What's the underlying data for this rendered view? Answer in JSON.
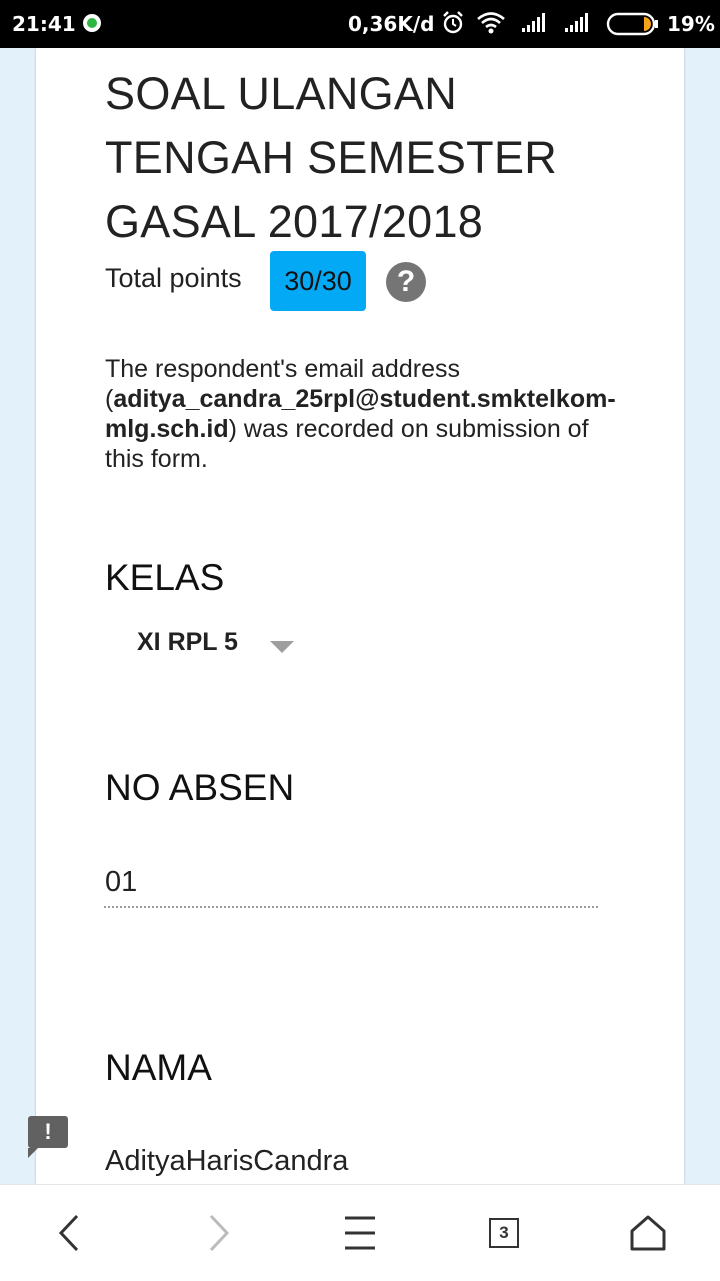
{
  "status_bar": {
    "time": "21:41",
    "network_speed": "0,36K/d",
    "battery": "19%",
    "icons": [
      "whatsapp-icon",
      "alarm-icon",
      "wifi-icon",
      "signal-icon",
      "signal-icon",
      "battery-icon"
    ]
  },
  "form": {
    "title": "SOAL ULANGAN TENGAH SEMESTER GASAL 2017/2018",
    "points_label": "Total points",
    "points_value": "30/30",
    "help_icon": "?",
    "email_prefix": "The respondent's email address (",
    "email": "aditya_candra_25rpl@student.smktelkom-mlg.sch.id",
    "email_suffix": ") was recorded on submission of this form.",
    "questions": [
      {
        "label": "KELAS",
        "type": "select",
        "value": "XI RPL 5"
      },
      {
        "label": "NO ABSEN",
        "type": "text",
        "value": "01"
      },
      {
        "label": "NAMA",
        "type": "text",
        "value": "AdityaHarisCandra"
      }
    ]
  },
  "feedback_icon": "!",
  "nav_bar": {
    "tab_count": "3",
    "icons": [
      "back-icon",
      "forward-icon",
      "menu-icon",
      "tabs-icon",
      "home-icon"
    ]
  },
  "colors": {
    "badge": "#03a9f4",
    "page_background": "#e3f1fb",
    "status_bar": "#000000"
  }
}
